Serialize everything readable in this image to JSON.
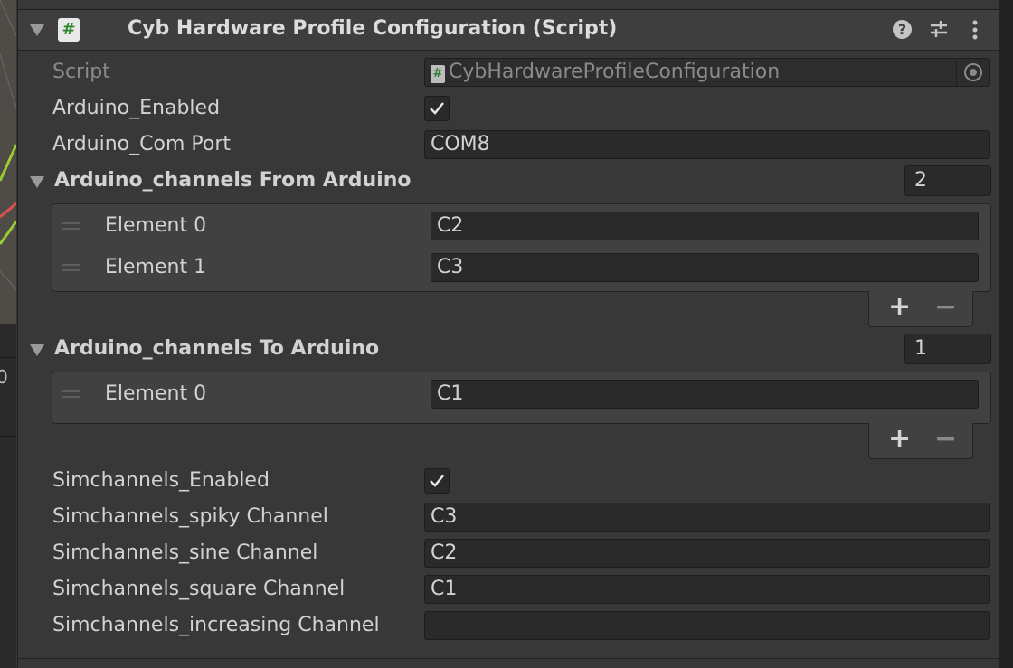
{
  "component": {
    "title": "Cyb Hardware Profile Configuration (Script)",
    "icon": "script-icon",
    "icon_glyph": "#"
  },
  "sidebar_fragment": "0",
  "fields": {
    "script": {
      "label": "Script",
      "value": "CybHardwareProfileConfiguration",
      "icon_glyph": "#"
    },
    "arduino_enabled": {
      "label": "Arduino_Enabled",
      "checked": true
    },
    "arduino_com_port": {
      "label": "Arduino_Com Port",
      "value": "COM8"
    },
    "simchannels_enabled": {
      "label": "Simchannels_Enabled",
      "checked": true
    },
    "simchannels_spiky": {
      "label": "Simchannels_spiky Channel",
      "value": "C3"
    },
    "simchannels_sine": {
      "label": "Simchannels_sine Channel",
      "value": "C2"
    },
    "simchannels_square": {
      "label": "Simchannels_square Channel",
      "value": "C1"
    },
    "simchannels_increasing": {
      "label": "Simchannels_increasing Channel",
      "value": ""
    }
  },
  "lists": {
    "from_arduino": {
      "label": "Arduino_channels From Arduino",
      "size": "2",
      "elements": [
        {
          "label": "Element 0",
          "value": "C2"
        },
        {
          "label": "Element 1",
          "value": "C3"
        }
      ]
    },
    "to_arduino": {
      "label": "Arduino_channels To Arduino",
      "size": "1",
      "elements": [
        {
          "label": "Element 0",
          "value": "C1"
        }
      ]
    }
  },
  "buttons": {
    "add": "+",
    "remove": "−",
    "help": "?"
  },
  "colors": {
    "background": "#383838",
    "field": "#2a2a2a",
    "accent_green": "#2f8a2f"
  }
}
